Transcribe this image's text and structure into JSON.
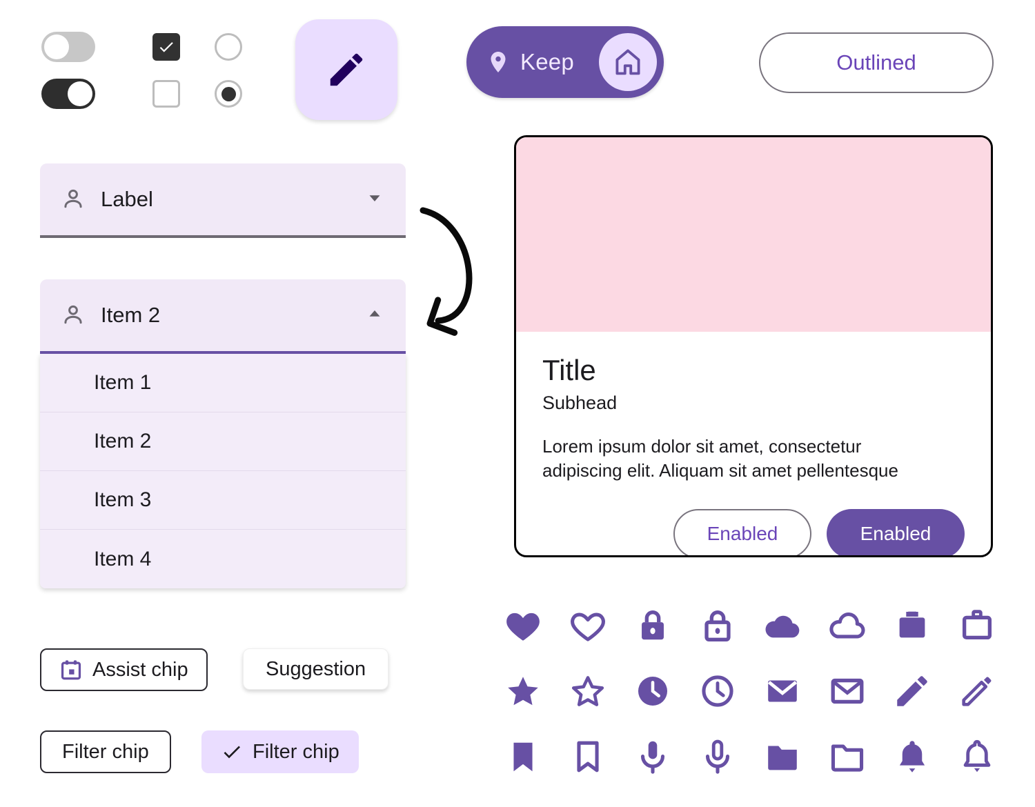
{
  "controls": {
    "switch_off": {
      "name": "switch-off",
      "state": "off"
    },
    "switch_on": {
      "name": "switch-on",
      "state": "on"
    },
    "checkbox_checked": {
      "state": "checked"
    },
    "checkbox_unchecked": {
      "state": "unchecked"
    },
    "radio_unselected": {
      "state": "unselected"
    },
    "radio_selected": {
      "state": "selected"
    },
    "fab": {
      "icon": "pencil-icon"
    }
  },
  "buttons": {
    "keep": {
      "label": "Keep",
      "leading_icon": "location-pin-icon",
      "trailing_icon": "home-icon",
      "bg": "#6750A4",
      "badge_bg": "#EADDFF"
    },
    "outlined": {
      "label": "Outlined",
      "text_color": "#6A45B8",
      "border_color": "#79747E"
    }
  },
  "dropdown_collapsed": {
    "icon": "person-icon",
    "value": "Label",
    "arrow": "chevron-down-icon",
    "underline_color": "#6E6A73"
  },
  "dropdown_expanded": {
    "icon": "person-icon",
    "value": "Item 2",
    "arrow": "chevron-up-icon",
    "underline_color": "#6750A4",
    "options": [
      "Item 1",
      "Item 2",
      "Item 3",
      "Item 4"
    ]
  },
  "chips": {
    "assist": {
      "label": "Assist chip",
      "icon": "calendar-icon",
      "style": "outlined"
    },
    "suggestion": {
      "label": "Suggestion",
      "style": "elevated"
    },
    "filter_unselected": {
      "label": "Filter chip",
      "style": "outlined"
    },
    "filter_selected": {
      "label": "Filter chip",
      "icon": "check-icon",
      "style": "selected",
      "bg": "#EADDFF"
    }
  },
  "card": {
    "media_color": "#FCD9E3",
    "title": "Title",
    "subhead": "Subhead",
    "body": "Lorem ipsum dolor sit amet, consectetur adipiscing elit. Aliquam sit amet pellentesque",
    "action_outlined": "Enabled",
    "action_filled": "Enabled"
  },
  "icon_grid": {
    "color": "#6750A4",
    "rows": [
      [
        "heart-filled-icon",
        "heart-outlined-icon",
        "lock-filled-icon",
        "lock-outlined-icon",
        "cloud-filled-icon",
        "cloud-outlined-icon",
        "briefcase-filled-icon",
        "briefcase-outlined-icon"
      ],
      [
        "star-filled-icon",
        "star-outlined-icon",
        "clock-filled-icon",
        "clock-outlined-icon",
        "mail-filled-icon",
        "mail-outlined-icon",
        "pencil-filled-icon",
        "pencil-outlined-icon"
      ],
      [
        "bookmark-filled-icon",
        "bookmark-outlined-icon",
        "mic-filled-icon",
        "mic-outlined-icon",
        "folder-filled-icon",
        "folder-outlined-icon",
        "bell-filled-icon",
        "bell-outlined-icon"
      ]
    ]
  },
  "annotation": {
    "arrow": "curved-arrow-icon"
  }
}
